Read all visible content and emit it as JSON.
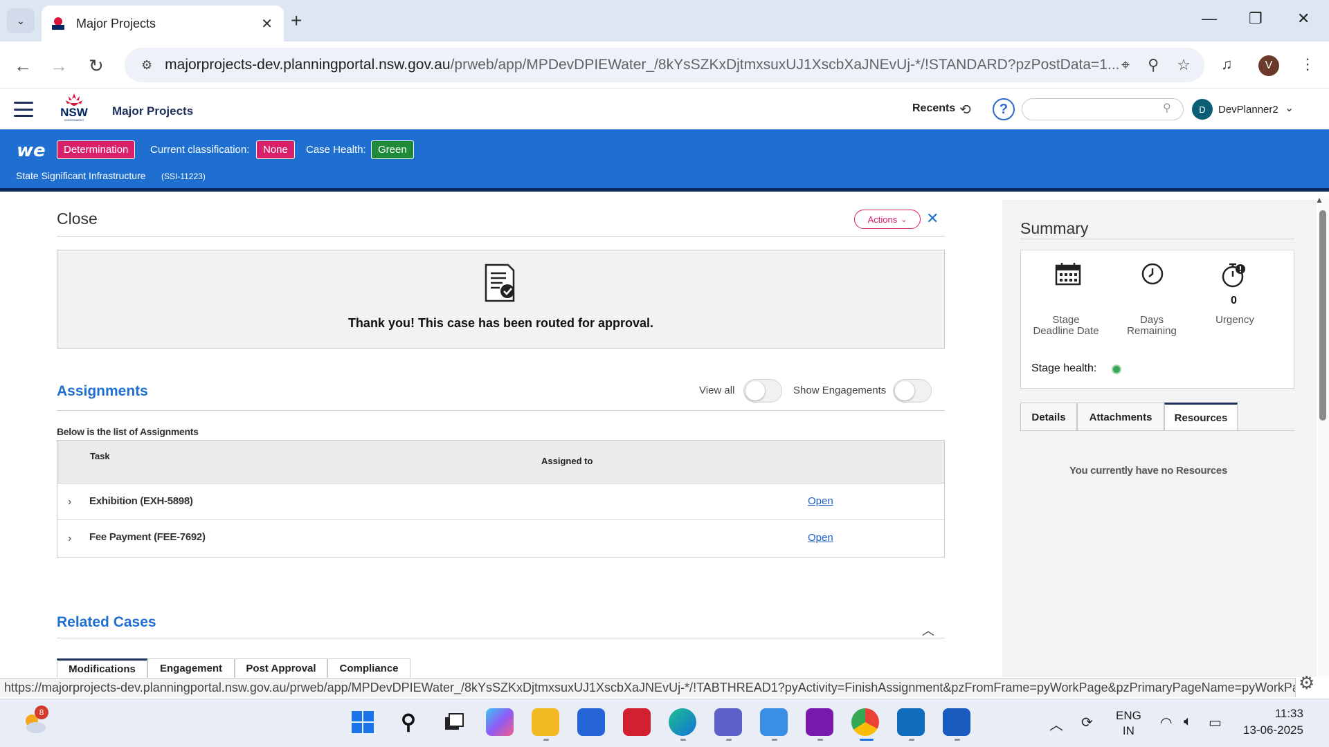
{
  "browser": {
    "tab_title": "Major Projects",
    "url_host": "majorprojects-dev.planningportal.nsw.gov.au",
    "url_path": "/prweb/app/MPDevDPIEWater_/8kYsSZKxDjtmxsuxUJ1XscbXaJNEvUj-*/!STANDARD?pzPostData=1...",
    "profile_initial": "V",
    "status_url": "https://majorprojects-dev.planningportal.nsw.gov.au/prweb/app/MPDevDPIEWater_/8kYsSZKxDjtmxsuxUJ1XscbXaJNEvUj-*/!TABTHREAD1?pyActivity=FinishAssignment&pzFromFrame=pyWorkPage&pzPrimaryPageName=pyWorkPag..."
  },
  "header": {
    "logo_text": "NSW",
    "logo_sub": "GOVERNMENT",
    "app_title": "Major Projects",
    "recents_label": "Recents",
    "help_symbol": "?",
    "user_initial": "D",
    "user_name": "DevPlanner2"
  },
  "banner": {
    "logo": "we",
    "stage_badge": "Determination",
    "classification_label": "Current classification:",
    "classification_value": "None",
    "health_label": "Case Health:",
    "health_value": "Green",
    "case_type": "State Significant Infrastructure",
    "case_id": "(SSI-11223)"
  },
  "main": {
    "close_title": "Close",
    "actions_label": "Actions",
    "confirm_message": "Thank you! This case has been routed for approval.",
    "assignments": {
      "title": "Assignments",
      "view_all_label": "View all",
      "show_engagements_label": "Show Engagements",
      "subtitle": "Below is the list of Assignments",
      "col_task": "Task",
      "col_assigned": "Assigned to",
      "rows": [
        {
          "task": "Exhibition (EXH-5898)",
          "action": "Open"
        },
        {
          "task": "Fee Payment (FEE-7692)",
          "action": "Open"
        }
      ]
    },
    "related": {
      "title": "Related Cases",
      "tabs": [
        "Modifications",
        "Engagement",
        "Post Approval",
        "Compliance"
      ]
    }
  },
  "summary": {
    "title": "Summary",
    "stage_deadline_label_1": "Stage",
    "stage_deadline_label_2": "Deadline Date",
    "days_remaining_label_1": "Days",
    "days_remaining_label_2": "Remaining",
    "urgency_value": "0",
    "urgency_label": "Urgency",
    "stage_health_label": "Stage health:",
    "health_color": "#3aa655",
    "tabs": [
      "Details",
      "Attachments",
      "Resources"
    ],
    "active_tab": "Resources",
    "empty_message": "You currently have no Resources"
  },
  "taskbar": {
    "weather_badge": "8",
    "lang_1": "ENG",
    "lang_2": "IN",
    "time": "11:33",
    "date": "13-06-2025",
    "icons": [
      "windows-start",
      "search",
      "task-view",
      "m365",
      "file-explorer",
      "microsoft-store",
      "security",
      "edge",
      "teams",
      "notepad",
      "onenote",
      "chrome",
      "outlook",
      "word"
    ]
  },
  "colors": {
    "banner_blue": "#1f6fd1",
    "badge_pink": "#d8206b",
    "badge_green": "#1e8a3a",
    "link_blue": "#1f5fc6",
    "heading_blue": "#1f6fd1"
  }
}
